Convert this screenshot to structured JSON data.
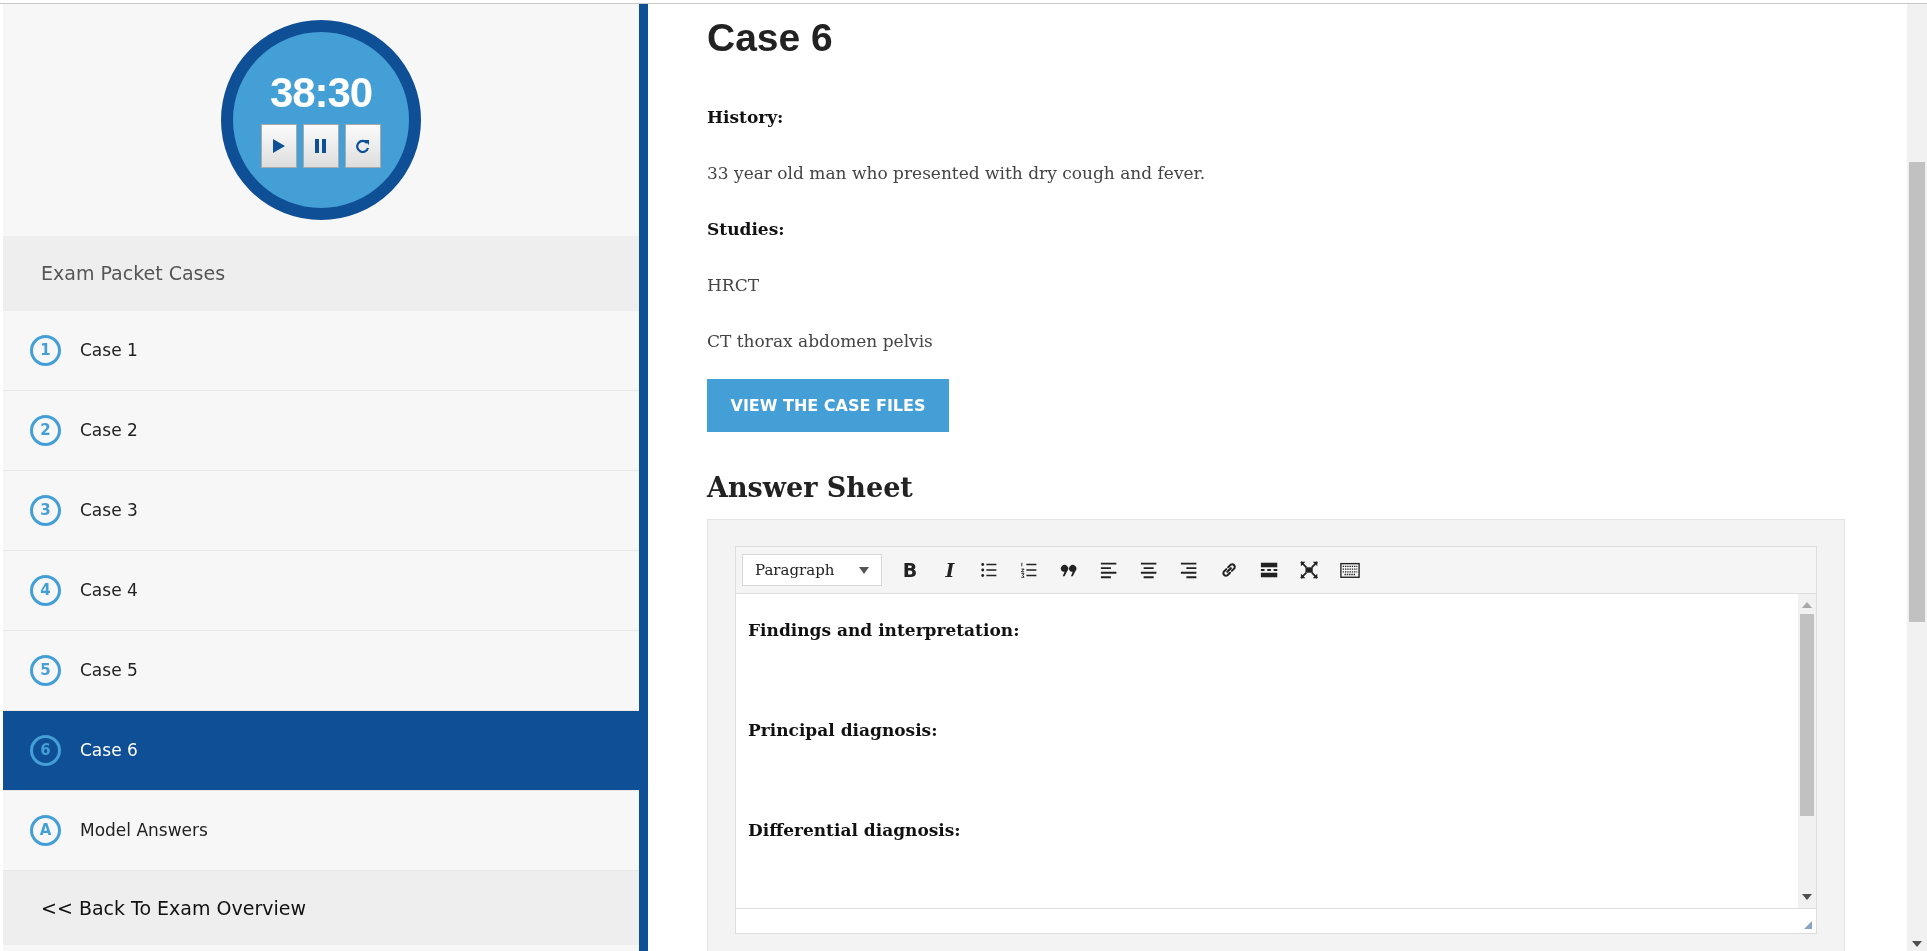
{
  "timer": {
    "time": "38:30",
    "controls": [
      {
        "kind": "play"
      },
      {
        "kind": "pause"
      },
      {
        "kind": "restart"
      }
    ]
  },
  "sidebar": {
    "heading": "Exam Packet Cases",
    "items": [
      {
        "badge": "1",
        "label": "Case 1",
        "selected": false
      },
      {
        "badge": "2",
        "label": "Case 2",
        "selected": false
      },
      {
        "badge": "3",
        "label": "Case 3",
        "selected": false
      },
      {
        "badge": "4",
        "label": "Case 4",
        "selected": false
      },
      {
        "badge": "5",
        "label": "Case 5",
        "selected": false
      },
      {
        "badge": "6",
        "label": "Case 6",
        "selected": true
      },
      {
        "badge": "A",
        "label": "Model Answers",
        "selected": false
      }
    ],
    "back_link": "<< Back To Exam Overview"
  },
  "main": {
    "title": "Case 6",
    "sections": [
      {
        "kind": "heading",
        "text": "History:"
      },
      {
        "kind": "paragraph",
        "text": "33 year old man who presented with dry cough and fever."
      },
      {
        "kind": "heading",
        "text": "Studies:"
      },
      {
        "kind": "paragraph",
        "text": "HRCT"
      },
      {
        "kind": "paragraph",
        "text": "CT thorax abdomen pelvis"
      }
    ],
    "button": "VIEW THE CASE FILES",
    "answer_sheet": {
      "title": "Answer Sheet",
      "format": "Paragraph",
      "toolbar": [
        {
          "kind": "bold",
          "label": "B"
        },
        {
          "kind": "italic",
          "label": "I"
        },
        {
          "kind": "bullet-list"
        },
        {
          "kind": "numbered-list"
        },
        {
          "kind": "quote"
        },
        {
          "kind": "align-left"
        },
        {
          "kind": "align-center"
        },
        {
          "kind": "align-right"
        },
        {
          "kind": "link"
        },
        {
          "kind": "read-more"
        },
        {
          "kind": "fullscreen"
        },
        {
          "kind": "keyboard"
        }
      ],
      "lines": [
        "Findings and interpretation:",
        "Principal diagnosis:",
        "Differential diagnosis:"
      ]
    }
  }
}
